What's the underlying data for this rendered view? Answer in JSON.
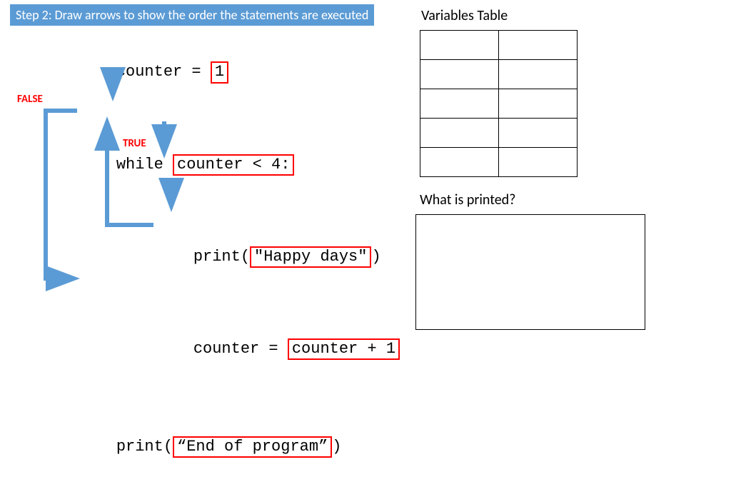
{
  "banner": "Step 2: Draw arrows to show the order the statements are executed",
  "code": {
    "l1_a": "counter = ",
    "l1_b": "1",
    "l2_a": "while ",
    "l2_b": "counter < 4:",
    "l3_a": "print(",
    "l3_b": "\"Happy days\"",
    "l3_c": ")",
    "l4_a": "counter = ",
    "l4_b": "counter + 1",
    "l5_a": "print(",
    "l5_b": "“End of program”",
    "l5_c": ")"
  },
  "labels": {
    "false": "FALSE",
    "true": "TRUE"
  },
  "vars_title": "Variables Table",
  "printed_title": "What is printed?",
  "colors": {
    "arrow": "#5B9BD5",
    "red": "#ff0000"
  }
}
